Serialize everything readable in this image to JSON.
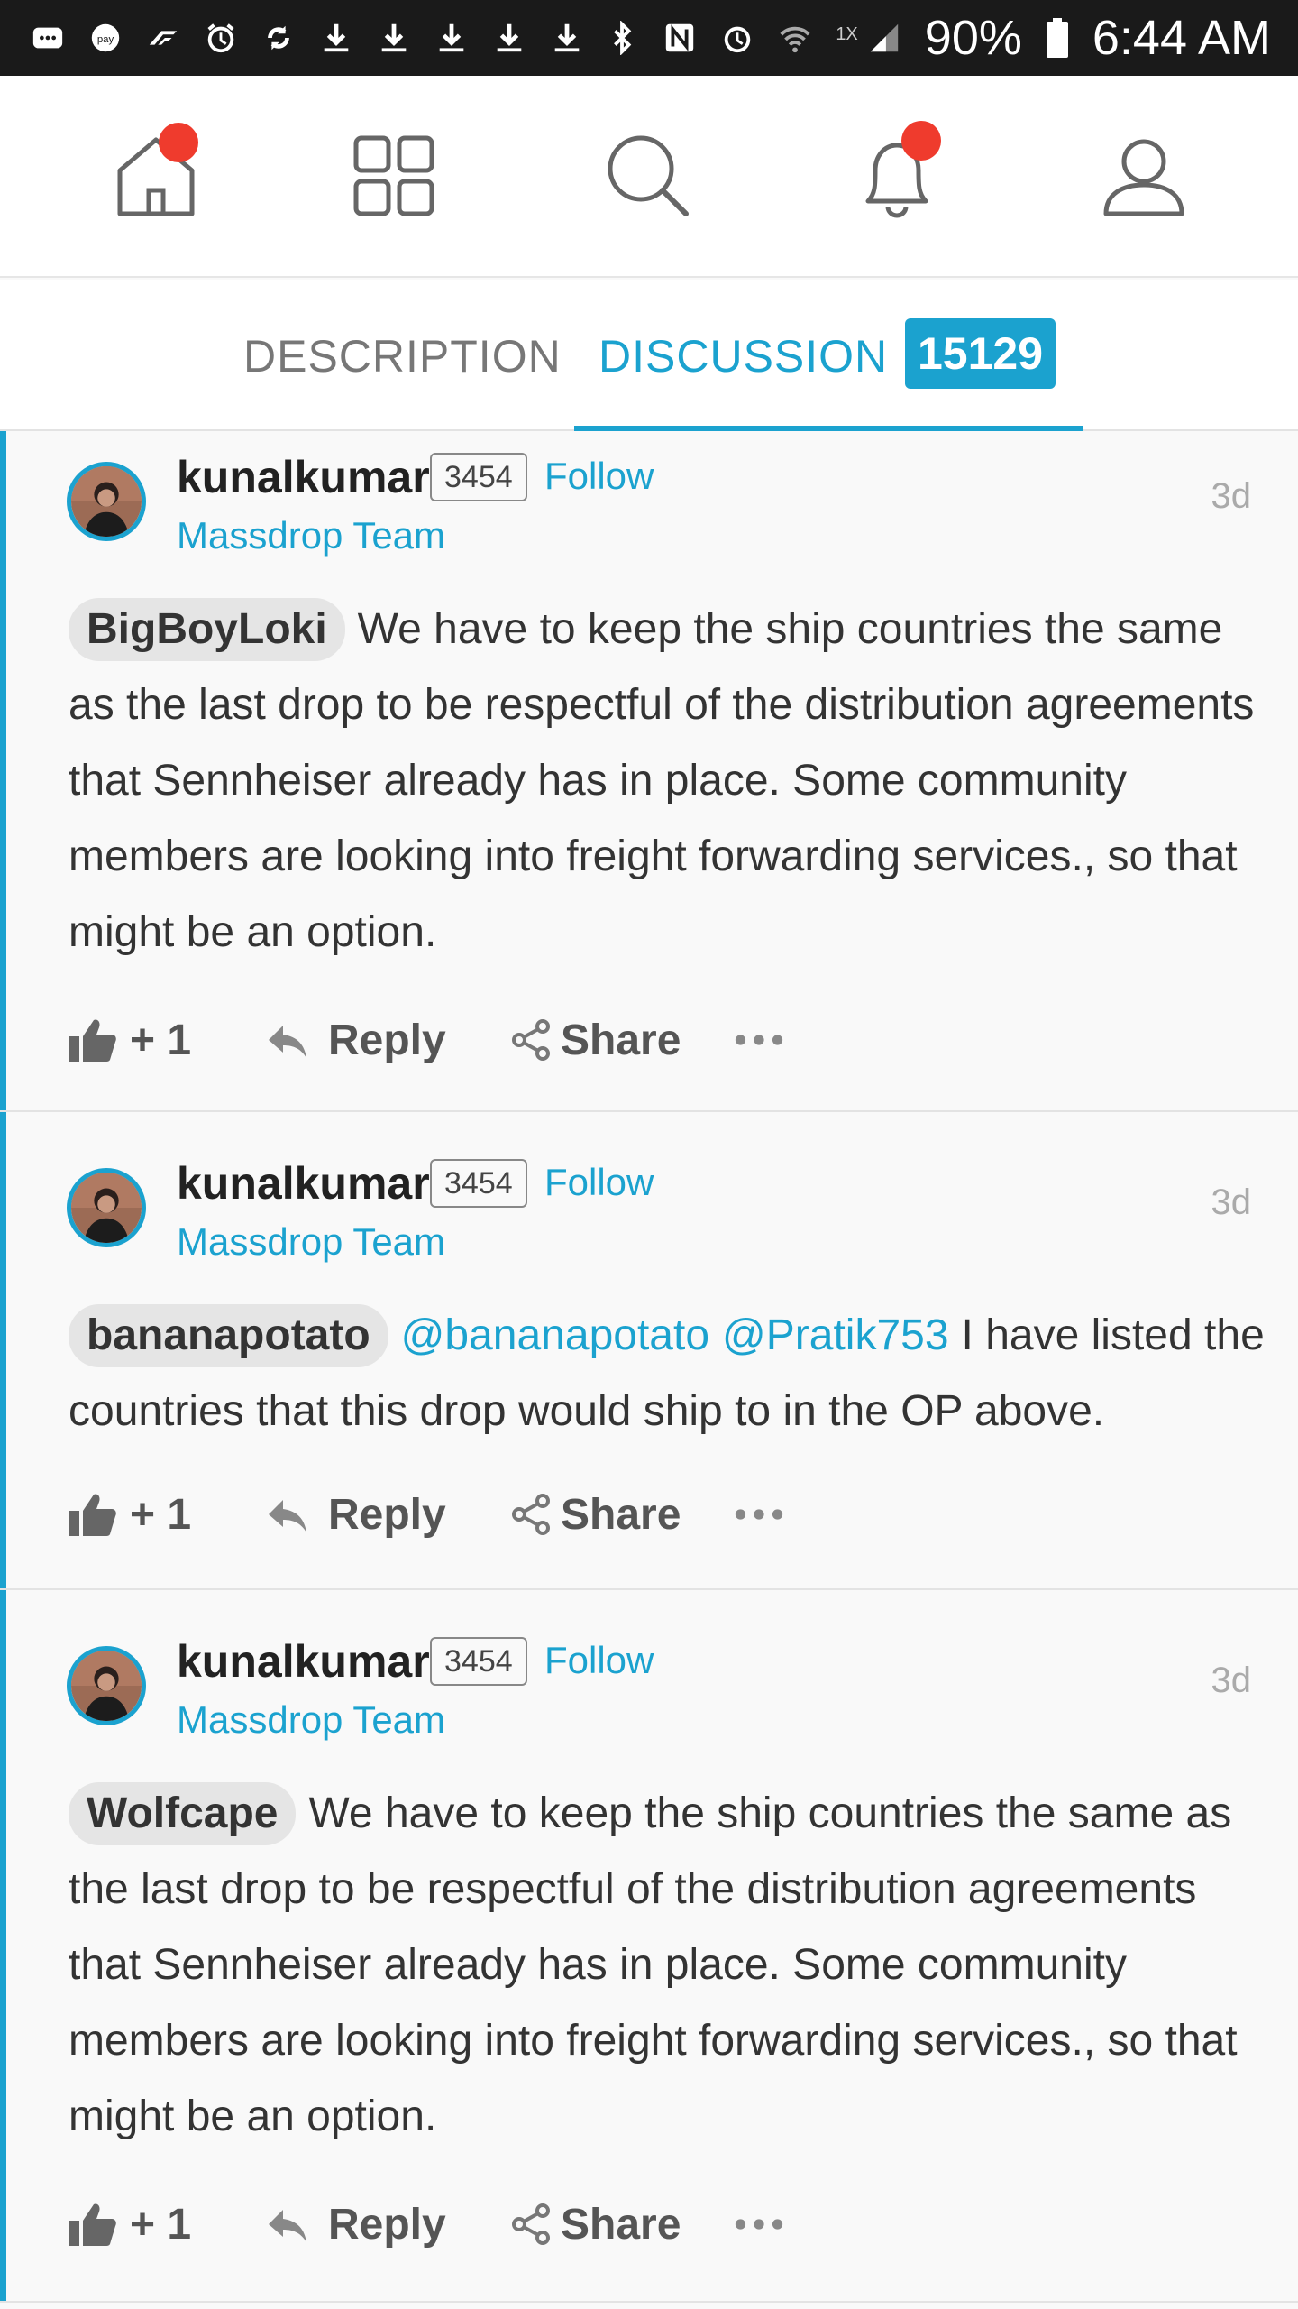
{
  "status_bar": {
    "network_label": "1X",
    "battery": "90%",
    "time": "6:44 AM"
  },
  "nav": {
    "items": [
      "home",
      "grid",
      "search",
      "notifications",
      "profile"
    ]
  },
  "tabs": {
    "description": "DESCRIPTION",
    "discussion": "DISCUSSION",
    "count": "15129"
  },
  "comments": [
    {
      "username": "kunalkumar",
      "reputation": "3454",
      "follow": "Follow",
      "team": "Massdrop Team",
      "time": "3d",
      "mention_chip": "BigBoyLoki",
      "text": "We have to keep the ship countries the same as the last drop to be respectful of the distribution agreements that Sennheiser already has in place. Some community members are looking into freight forwarding services., so that might be an option.",
      "likes": "+ 1",
      "reply": "Reply",
      "share": "Share"
    },
    {
      "username": "kunalkumar",
      "reputation": "3454",
      "follow": "Follow",
      "team": "Massdrop Team",
      "time": "3d",
      "mention_chip": "bananapotato",
      "mention_link_1": "@bananapotato",
      "mention_link_2": "@Pratik753",
      "text": "I have listed the countries that this drop would ship to in the OP above.",
      "likes": "+ 1",
      "reply": "Reply",
      "share": "Share"
    },
    {
      "username": "kunalkumar",
      "reputation": "3454",
      "follow": "Follow",
      "team": "Massdrop Team",
      "time": "3d",
      "mention_chip": "Wolfcape",
      "text": "We have to keep the ship countries the same as the last drop to be respectful of the distribution agreements that Sennheiser already has in place. Some community members are looking into freight forwarding services., so that might be an option.",
      "likes": "+ 1",
      "reply": "Reply",
      "share": "Share"
    }
  ],
  "colors": {
    "accent": "#1ba2cf",
    "badge_red": "#ef3b2d",
    "status_bar": "#1a1a1a"
  }
}
